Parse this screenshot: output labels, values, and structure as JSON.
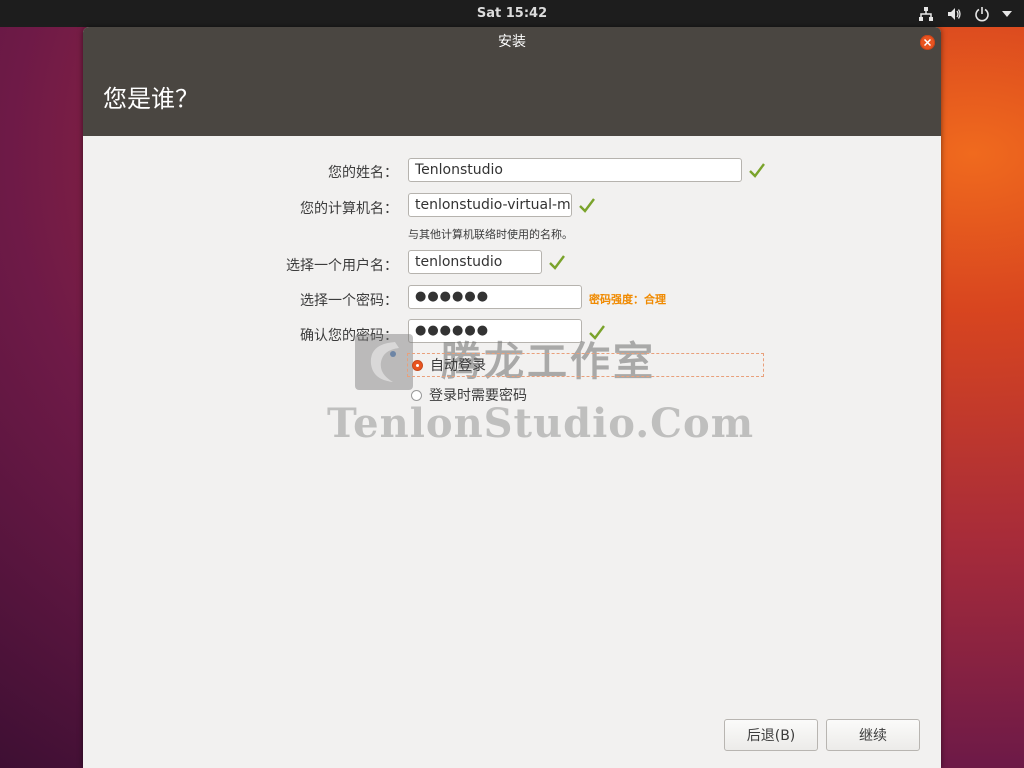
{
  "topbar": {
    "clock": "Sat 15:42",
    "icons": [
      "network-icon",
      "volume-icon",
      "power-icon",
      "chevron-down-icon"
    ]
  },
  "window": {
    "title": "安装",
    "heading": "您是谁？",
    "close_icon": "close-icon"
  },
  "form": {
    "name_label": "您的姓名：",
    "name_value": "Tenlonstudio",
    "computer_label": "您的计算机名：",
    "computer_value": "tenlonstudio-virtual-m",
    "computer_hint": "与其他计算机联络时使用的名称。",
    "username_label": "选择一个用户名：",
    "username_value": "tenlonstudio",
    "password_label": "选择一个密码：",
    "password_value": "●●●●●●",
    "password_strength": "密码强度：合理",
    "confirm_label": "确认您的密码：",
    "confirm_value": "●●●●●●",
    "login_options": [
      {
        "label": "自动登录",
        "selected": true
      },
      {
        "label": "登录时需要密码",
        "selected": false
      }
    ]
  },
  "watermark": {
    "chinese": "腾龙工作室",
    "english": "TenlonStudio.Com"
  },
  "buttons": {
    "back": "后退(B)",
    "continue": "继续"
  },
  "colors": {
    "accent": "#e95420",
    "check": "#7aa32b",
    "strength": "#f08a00",
    "header": "#4a4641"
  }
}
